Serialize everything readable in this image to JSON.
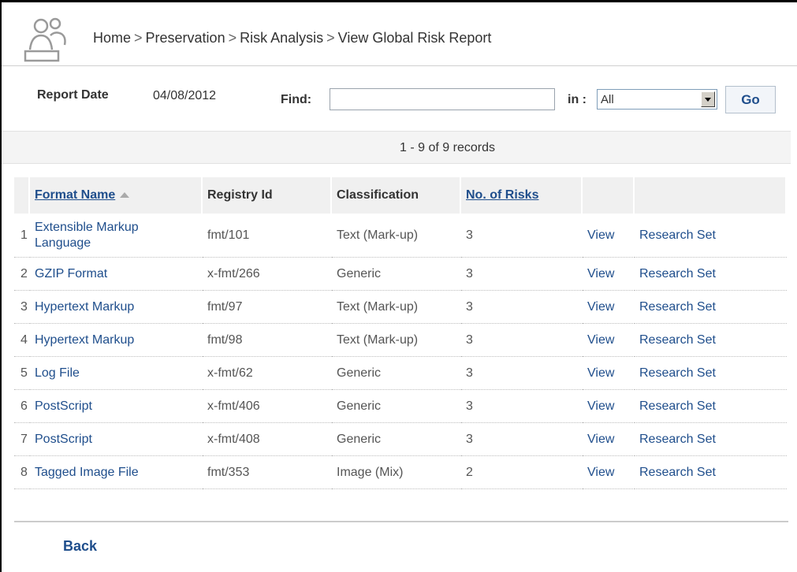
{
  "breadcrumb": [
    "Home",
    "Preservation",
    "Risk Analysis",
    "View Global Risk Report"
  ],
  "filter": {
    "report_date_label": "Report Date",
    "report_date_value": "04/08/2012",
    "find_label": "Find:",
    "find_value": "",
    "in_label": "in :",
    "in_selected": "All",
    "go_label": "Go"
  },
  "records_text": "1 - 9 of 9 records",
  "table": {
    "headers": [
      "Format Name",
      "Registry Id",
      "Classification",
      "No. of Risks",
      "",
      ""
    ],
    "rows": [
      {
        "num": "1",
        "name": "Extensible Markup Language",
        "registry": "fmt/101",
        "classification": "Text (Mark-up)",
        "risks": "3",
        "view": "View",
        "research": "Research Set"
      },
      {
        "num": "2",
        "name": "GZIP Format",
        "registry": "x-fmt/266",
        "classification": "Generic",
        "risks": "3",
        "view": "View",
        "research": "Research Set"
      },
      {
        "num": "3",
        "name": "Hypertext Markup",
        "registry": "fmt/97",
        "classification": "Text (Mark-up)",
        "risks": "3",
        "view": "View",
        "research": "Research Set"
      },
      {
        "num": "4",
        "name": "Hypertext Markup",
        "registry": "fmt/98",
        "classification": "Text (Mark-up)",
        "risks": "3",
        "view": "View",
        "research": "Research Set"
      },
      {
        "num": "5",
        "name": "Log File",
        "registry": "x-fmt/62",
        "classification": "Generic",
        "risks": "3",
        "view": "View",
        "research": "Research Set"
      },
      {
        "num": "6",
        "name": "PostScript",
        "registry": "x-fmt/406",
        "classification": "Generic",
        "risks": "3",
        "view": "View",
        "research": "Research Set"
      },
      {
        "num": "7",
        "name": "PostScript",
        "registry": "x-fmt/408",
        "classification": "Generic",
        "risks": "3",
        "view": "View",
        "research": "Research Set"
      },
      {
        "num": "8",
        "name": "Tagged Image File",
        "registry": "fmt/353",
        "classification": "Image (Mix)",
        "risks": "2",
        "view": "View",
        "research": "Research Set"
      }
    ]
  },
  "back_label": "Back",
  "icons": {
    "header": "users-icon",
    "sort": "sort-ascending-icon",
    "dropdown": "chevron-down-icon"
  },
  "colors": {
    "link": "#1f4e8c",
    "header_bg": "#f0f0f0",
    "text": "#333333"
  }
}
